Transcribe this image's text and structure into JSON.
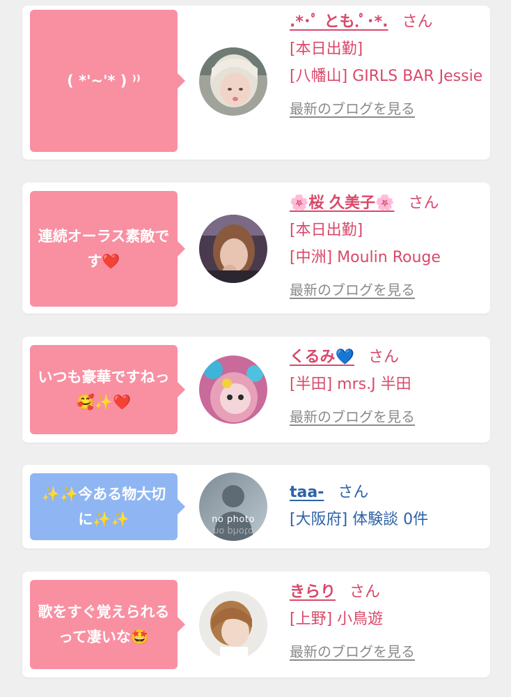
{
  "cards": [
    {
      "bubble_text": "( *'~'* ) ⁾⁾",
      "name": ".*･ﾟ とも.ﾟ･*.",
      "honorific": "さん",
      "shop_lines": [
        "[本日出勤]",
        "[八幡山] GIRLS BAR Jessie"
      ],
      "blog_link": "最新のブログを見る"
    },
    {
      "bubble_text": "連続オーラス素敵です❤️",
      "name": "🌸桜 久美子🌸",
      "honorific": "さん",
      "shop_lines": [
        "[本日出勤]",
        "[中洲] Moulin Rouge"
      ],
      "blog_link": "最新のブログを見る"
    },
    {
      "bubble_text": "いつも豪華ですねっ🥰✨❤️",
      "name": "くるみ💙",
      "honorific": "さん",
      "shop_lines": [
        "[半田] mrs.J 半田"
      ],
      "blog_link": "最新のブログを見る"
    },
    {
      "bubble_text": "✨✨今ある物大切に✨✨",
      "name": "taa-",
      "honorific": "さん",
      "shop_lines": [
        "[大阪府] 体験談 0件"
      ],
      "avatar_text": "no photo"
    },
    {
      "bubble_text": "歌をすぐ覚えられるって凄いな🤩",
      "name": "きらり",
      "honorific": "さん",
      "shop_lines": [
        "[上野] 小鳥遊"
      ],
      "blog_link": "最新のブログを見る"
    }
  ],
  "colors": {
    "pink_bubble": "#f890a2",
    "blue_bubble": "#8fb6f2",
    "pink_text": "#d9486a",
    "blue_text": "#2c62a8",
    "link_gray": "#8a8a8a",
    "background": "#efefef"
  }
}
